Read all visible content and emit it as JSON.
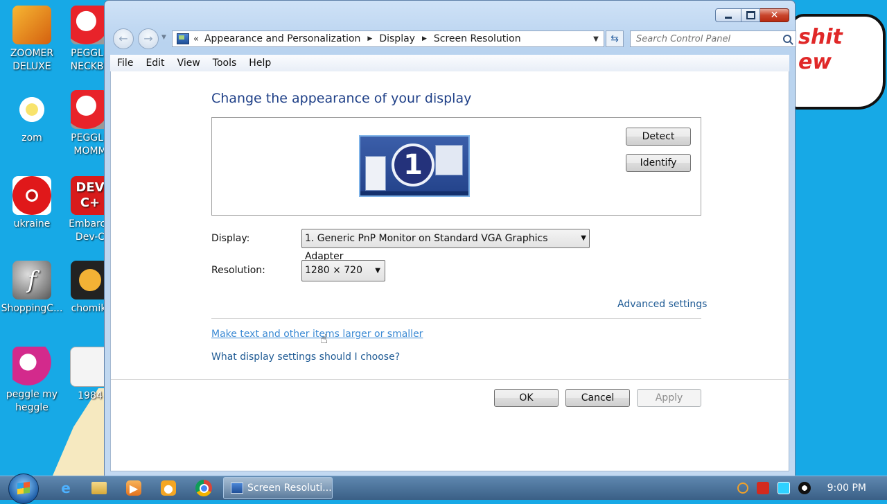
{
  "desktop": {
    "icons": [
      {
        "label": "ZOOMER\nDELUXE",
        "icon": "zoomer-icon"
      },
      {
        "label": "PEGGLE\nNECKBE",
        "icon": "peggle-icon"
      },
      {
        "label": "zom",
        "icon": "flower-icon"
      },
      {
        "label": "PEGGLE\nMOMM",
        "icon": "peggle-icon"
      },
      {
        "label": "ukraine",
        "icon": "radiation-icon"
      },
      {
        "label": "Embarca\nDev-C",
        "icon": "devcpp-icon"
      },
      {
        "label": "ShoppingC...",
        "icon": "flash-icon"
      },
      {
        "label": "chomikl",
        "icon": "clock-icon"
      },
      {
        "label": "peggle my\nheggle",
        "icon": "peggle-icon"
      },
      {
        "label": "1984",
        "icon": "text-file-icon"
      }
    ],
    "wallpaper_text": [
      "shit",
      "ew"
    ]
  },
  "window": {
    "caption_buttons": {
      "minimize": "minimize-icon",
      "maximize": "maximize-icon",
      "close": "✕"
    },
    "nav": {
      "back": "←",
      "forward": "→",
      "breadcrumb_prefix": "«",
      "breadcrumb": [
        "Appearance and Personalization",
        "Display",
        "Screen Resolution"
      ],
      "separator": "▶",
      "refresh": "⇆"
    },
    "search": {
      "placeholder": "Search Control Panel"
    },
    "menu": [
      "File",
      "Edit",
      "View",
      "Tools",
      "Help"
    ]
  },
  "main": {
    "title": "Change the appearance of your display",
    "monitor_number": "1",
    "detect_label": "Detect",
    "identify_label": "Identify",
    "display_label": "Display:",
    "display_value": "1. Generic PnP Monitor on Standard VGA Graphics Adapter",
    "resolution_label": "Resolution:",
    "resolution_value": "1280 × 720",
    "advanced_link": "Advanced settings",
    "text_size_link": "Make text and other items larger or smaller",
    "help_link": "What display settings should I choose?",
    "ok_label": "OK",
    "cancel_label": "Cancel",
    "apply_label": "Apply"
  },
  "taskbar": {
    "task_label": "Screen Resoluti...",
    "pinned": [
      "ie-icon",
      "explorer-icon",
      "media-player-icon",
      "camera-icon",
      "chrome-icon"
    ],
    "clock": "9:00 PM"
  },
  "colors": {
    "desktop": "#17a9e6",
    "title": "#1e3f87",
    "link": "#1e5a94",
    "link_hover": "#3b8ad4"
  }
}
